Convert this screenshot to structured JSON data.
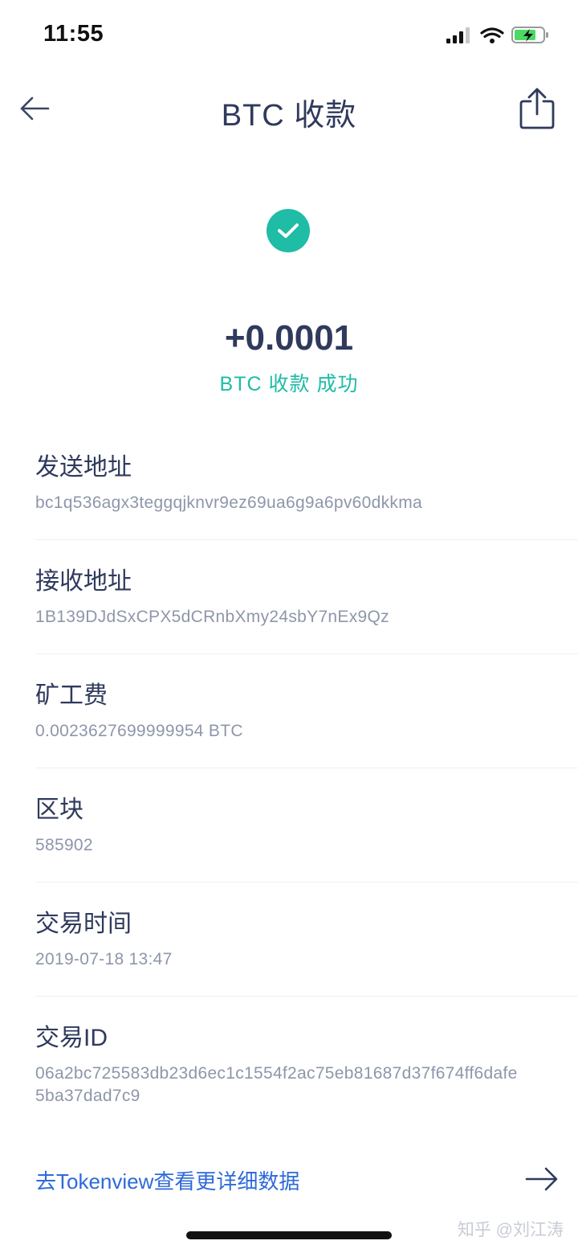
{
  "status_bar": {
    "time": "11:55"
  },
  "nav": {
    "title": "BTC 收款",
    "back_icon": "back-arrow-icon",
    "share_icon": "share-icon"
  },
  "summary": {
    "icon": "check-circle-icon",
    "amount": "+0.0001",
    "status": "BTC 收款 成功"
  },
  "details": [
    {
      "label": "发送地址",
      "value": "bc1q536agx3teggqjknvr9ez69ua6g9a6pv60dkkma"
    },
    {
      "label": "接收地址",
      "value": "1B139DJdSxCPX5dCRnbXmy24sbY7nEx9Qz"
    },
    {
      "label": "矿工费",
      "value": "0.0023627699999954 BTC"
    },
    {
      "label": "区块",
      "value": "585902"
    },
    {
      "label": "交易时间",
      "value": "2019-07-18 13:47"
    },
    {
      "label": "交易ID",
      "value": "06a2bc725583db23d6ec1c1554f2ac75eb81687d37f674ff6dafe5ba37dad7c9"
    }
  ],
  "footer": {
    "link_text": "去Tokenview查看更详细数据",
    "watermark": "知乎 @刘江涛"
  },
  "colors": {
    "accent": "#1fbca6",
    "link": "#2f6ad9",
    "text_primary": "#2f3a5c",
    "text_secondary": "#8e96aa"
  }
}
